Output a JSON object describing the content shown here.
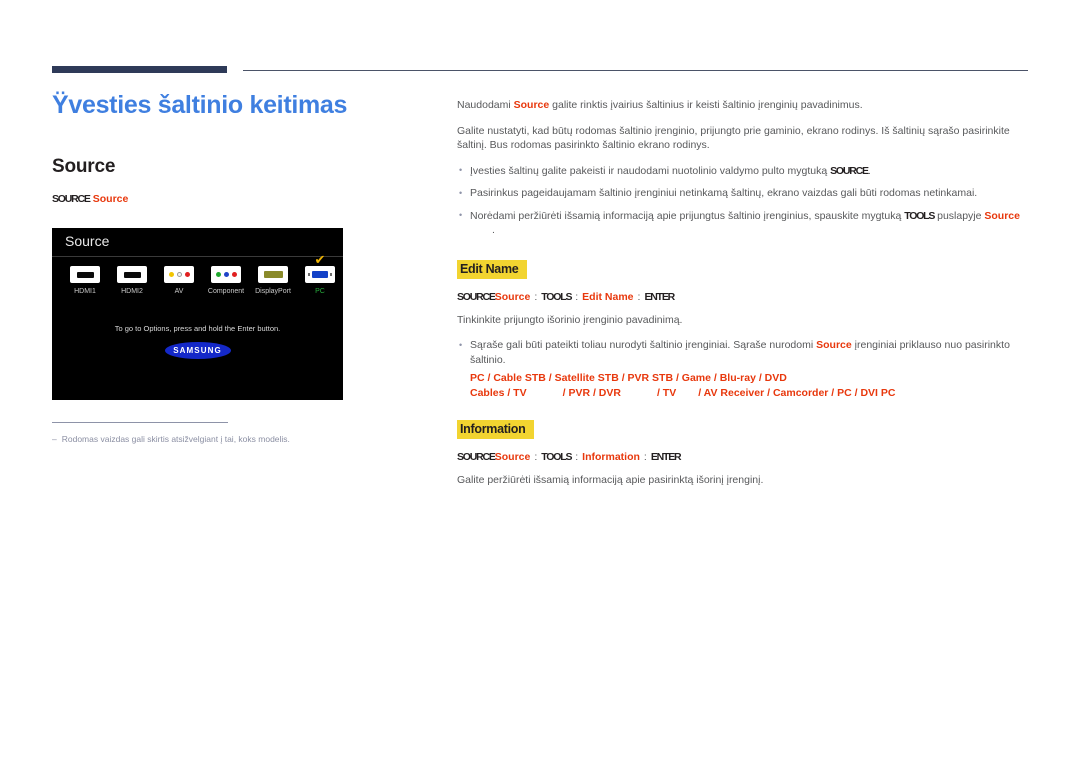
{
  "chapter": {
    "title": "Ÿvesties šaltinio keitimas"
  },
  "left": {
    "section_title": "Source",
    "breadcrumb": {
      "key": "SOURCE",
      "arrow": "→",
      "target": "Source"
    },
    "tv": {
      "header": "Source",
      "hint": "To go to Options, press and hold the Enter button.",
      "logo": "SAMSUNG",
      "next_arrow": "›",
      "check_mark": "✔",
      "sources": [
        {
          "label": "HDMI1",
          "icon": "hdmi-icon",
          "selected": false
        },
        {
          "label": "HDMI2",
          "icon": "hdmi-icon",
          "selected": false
        },
        {
          "label": "AV",
          "icon": "av-rca-icon",
          "selected": false
        },
        {
          "label": "Component",
          "icon": "component-rca-icon",
          "selected": false
        },
        {
          "label": "DisplayPort",
          "icon": "displayport-icon",
          "selected": false
        },
        {
          "label": "PC",
          "icon": "vga-pc-icon",
          "selected": true
        }
      ]
    },
    "footnote": {
      "dash": "–",
      "text": "Rodomas vaizdas gali skirtis atsižvelgiant į tai, koks modelis."
    }
  },
  "right": {
    "intro_1_before": "Naudodami ",
    "intro_1_red": "Source",
    "intro_1_after": " galite rinktis įvairius šaltinius ir keisti šaltinio įrenginių pavadinimus.",
    "intro_2": "Galite nustatyti, kad būtų rodomas šaltinio įrenginio, prijungto prie gaminio, ekrano rodinys. Iš šaltinių sąrašo pasirinkite šaltinį. Bus rodomas pasirinkto šaltinio ekrano rodinys.",
    "bullets": [
      {
        "text_before": "Įvesties šaltinų galite pakeisti ir naudodami nuotolinio valdymo pulto mygtuką ",
        "key": "SOURCE",
        "text_after": "."
      },
      {
        "text_before": "Pasirinkus pageidaujamam šaltinio įrenginiui netinkamą šaltinų, ekrano vaizdas gali būti rodomas netinkamai.",
        "key": "",
        "text_after": ""
      },
      {
        "text_before": "Norėdami peržiūrėti išsamią informaciją apie prijungtus šaltinio įrenginius, spauskite mygtuką ",
        "key": "TOOLS",
        "text_after": " puslapyje ",
        "red": "Source",
        "tail": "."
      }
    ],
    "edit_name": {
      "heading": "Edit Name",
      "breadcrumb": {
        "key1": "SOURCE",
        "red1": "Source",
        "key2": "TOOLS",
        "red2": "Edit Name",
        "key3": "ENTER",
        "sep": ":"
      },
      "paragraph": "Tinkinkite prijungto išorinio įrenginio pavadinimą.",
      "bullet_before": "Sąraše gali būti pateikti toliau nurodyti šaltinio įrenginiai. Sąraše nurodomi ",
      "bullet_red": "Source",
      "bullet_after": " įrenginiai priklauso nuo pasirinkto šaltinio.",
      "devices_line1": "PC / Cable STB / Satellite STB / PVR STB / Game / Blu-ray / DVD",
      "devices_line2": "Cables / TV",
      "devices_line2b": "/ PVR / DVR",
      "devices_line2c": "/ TV",
      "devices_line2d": "/ AV Receiver / Camcorder / PC / DVI PC"
    },
    "information": {
      "heading": "Information",
      "breadcrumb": {
        "key1": "SOURCE",
        "red1": "Source",
        "key2": "TOOLS",
        "red2": "Information",
        "key3": "ENTER",
        "sep": ":"
      },
      "paragraph": "Galite peržiūrėti išsamią informaciją apie pasirinktą išorinį įrenginį."
    }
  },
  "colors": {
    "accent_blue": "#3f7fe0",
    "navy": "#2e3a58",
    "red": "#e8380d",
    "highlight": "#f2d430",
    "body_gray": "#58595b",
    "samsung_blue": "#1428c8"
  }
}
